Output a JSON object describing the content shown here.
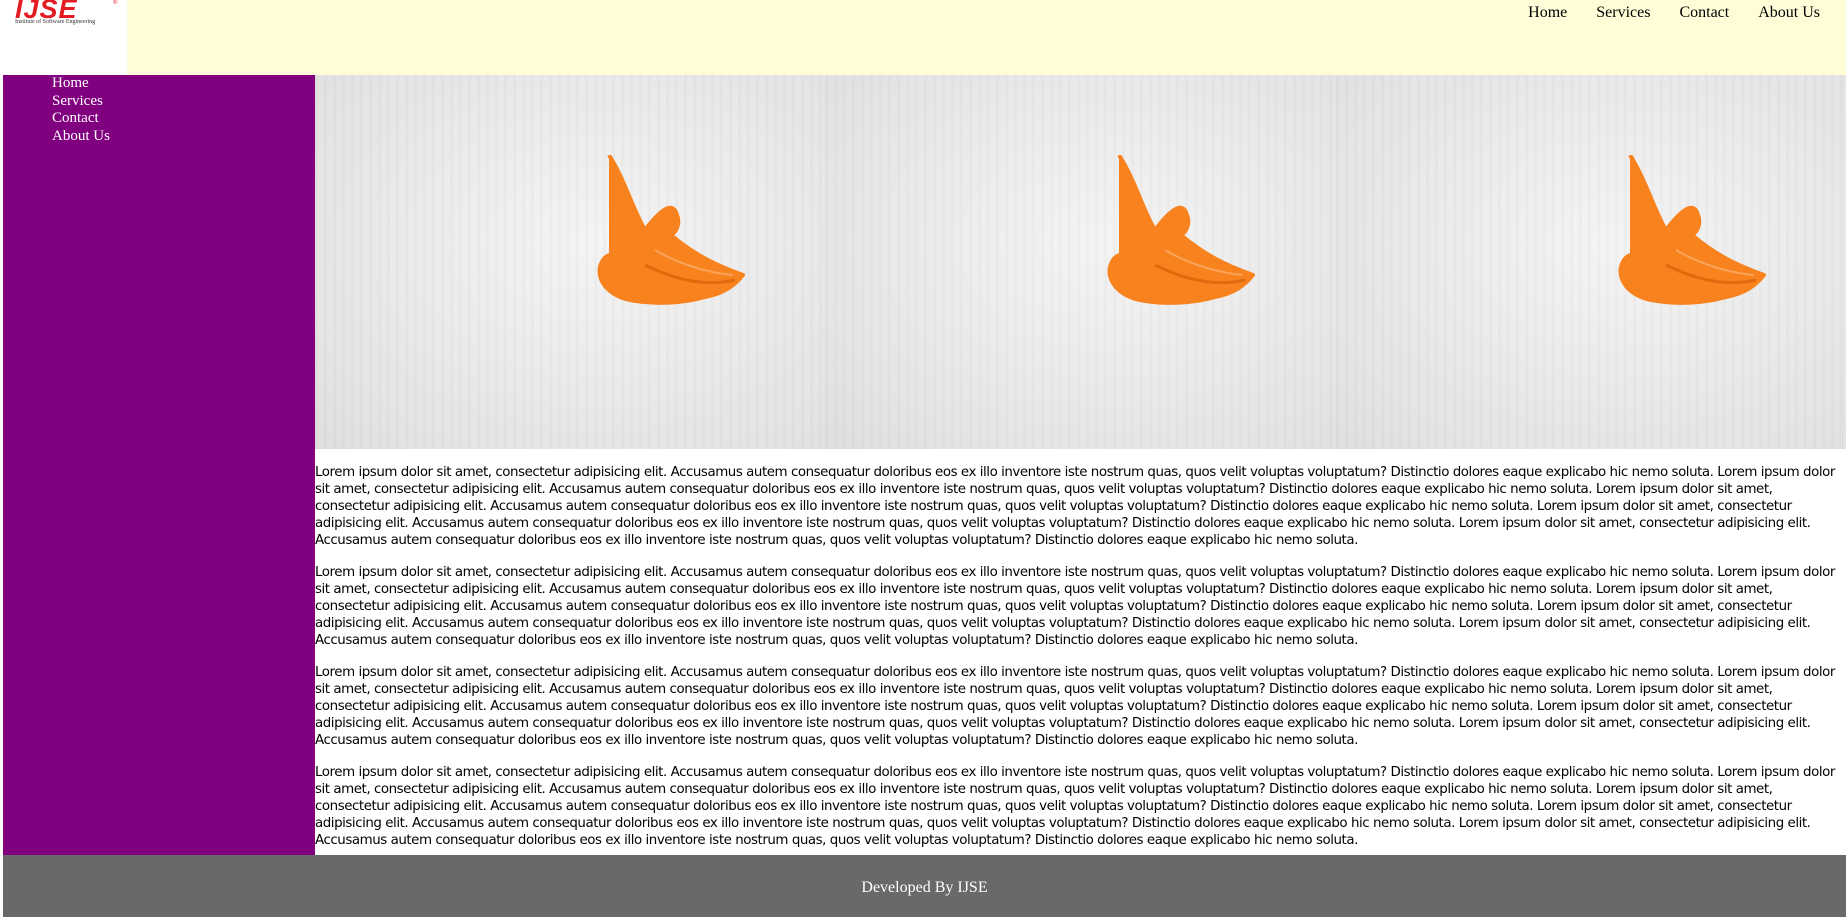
{
  "brand": {
    "logo_text": "IJSE",
    "logo_mark": "®",
    "logo_subtitle": "Institute of Software Engineering"
  },
  "header": {
    "nav": [
      "Home",
      "Services",
      "Contact",
      "About Us"
    ]
  },
  "sidebar": {
    "nav": [
      "Home",
      "Services",
      "Contact",
      "About Us"
    ]
  },
  "banner": {
    "image_icon": "orange-swirl-mascot-image",
    "tile_count": 3
  },
  "content": {
    "paragraphs": [
      "Lorem ipsum dolor sit amet, consectetur adipisicing elit. Accusamus autem consequatur doloribus eos ex illo inventore iste nostrum quas, quos velit voluptas voluptatum? Distinctio dolores eaque explicabo hic nemo soluta. Lorem ipsum dolor sit amet, consectetur adipisicing elit. Accusamus autem consequatur doloribus eos ex illo inventore iste nostrum quas, quos velit voluptas voluptatum? Distinctio dolores eaque explicabo hic nemo soluta. Lorem ipsum dolor sit amet, consectetur adipisicing elit. Accusamus autem consequatur doloribus eos ex illo inventore iste nostrum quas, quos velit voluptas voluptatum? Distinctio dolores eaque explicabo hic nemo soluta. Lorem ipsum dolor sit amet, consectetur adipisicing elit. Accusamus autem consequatur doloribus eos ex illo inventore iste nostrum quas, quos velit voluptas voluptatum? Distinctio dolores eaque explicabo hic nemo soluta. Lorem ipsum dolor sit amet, consectetur adipisicing elit. Accusamus autem consequatur doloribus eos ex illo inventore iste nostrum quas, quos velit voluptas voluptatum? Distinctio dolores eaque explicabo hic nemo soluta.",
      "Lorem ipsum dolor sit amet, consectetur adipisicing elit. Accusamus autem consequatur doloribus eos ex illo inventore iste nostrum quas, quos velit voluptas voluptatum? Distinctio dolores eaque explicabo hic nemo soluta. Lorem ipsum dolor sit amet, consectetur adipisicing elit. Accusamus autem consequatur doloribus eos ex illo inventore iste nostrum quas, quos velit voluptas voluptatum? Distinctio dolores eaque explicabo hic nemo soluta. Lorem ipsum dolor sit amet, consectetur adipisicing elit. Accusamus autem consequatur doloribus eos ex illo inventore iste nostrum quas, quos velit voluptas voluptatum? Distinctio dolores eaque explicabo hic nemo soluta. Lorem ipsum dolor sit amet, consectetur adipisicing elit. Accusamus autem consequatur doloribus eos ex illo inventore iste nostrum quas, quos velit voluptas voluptatum? Distinctio dolores eaque explicabo hic nemo soluta. Lorem ipsum dolor sit amet, consectetur adipisicing elit. Accusamus autem consequatur doloribus eos ex illo inventore iste nostrum quas, quos velit voluptas voluptatum? Distinctio dolores eaque explicabo hic nemo soluta.",
      "Lorem ipsum dolor sit amet, consectetur adipisicing elit. Accusamus autem consequatur doloribus eos ex illo inventore iste nostrum quas, quos velit voluptas voluptatum? Distinctio dolores eaque explicabo hic nemo soluta. Lorem ipsum dolor sit amet, consectetur adipisicing elit. Accusamus autem consequatur doloribus eos ex illo inventore iste nostrum quas, quos velit voluptas voluptatum? Distinctio dolores eaque explicabo hic nemo soluta. Lorem ipsum dolor sit amet, consectetur adipisicing elit. Accusamus autem consequatur doloribus eos ex illo inventore iste nostrum quas, quos velit voluptas voluptatum? Distinctio dolores eaque explicabo hic nemo soluta. Lorem ipsum dolor sit amet, consectetur adipisicing elit. Accusamus autem consequatur doloribus eos ex illo inventore iste nostrum quas, quos velit voluptas voluptatum? Distinctio dolores eaque explicabo hic nemo soluta. Lorem ipsum dolor sit amet, consectetur adipisicing elit. Accusamus autem consequatur doloribus eos ex illo inventore iste nostrum quas, quos velit voluptas voluptatum? Distinctio dolores eaque explicabo hic nemo soluta.",
      "Lorem ipsum dolor sit amet, consectetur adipisicing elit. Accusamus autem consequatur doloribus eos ex illo inventore iste nostrum quas, quos velit voluptas voluptatum? Distinctio dolores eaque explicabo hic nemo soluta. Lorem ipsum dolor sit amet, consectetur adipisicing elit. Accusamus autem consequatur doloribus eos ex illo inventore iste nostrum quas, quos velit voluptas voluptatum? Distinctio dolores eaque explicabo hic nemo soluta. Lorem ipsum dolor sit amet, consectetur adipisicing elit. Accusamus autem consequatur doloribus eos ex illo inventore iste nostrum quas, quos velit voluptas voluptatum? Distinctio dolores eaque explicabo hic nemo soluta. Lorem ipsum dolor sit amet, consectetur adipisicing elit. Accusamus autem consequatur doloribus eos ex illo inventore iste nostrum quas, quos velit voluptas voluptatum? Distinctio dolores eaque explicabo hic nemo soluta. Lorem ipsum dolor sit amet, consectetur adipisicing elit. Accusamus autem consequatur doloribus eos ex illo inventore iste nostrum quas, quos velit voluptas voluptatum? Distinctio dolores eaque explicabo hic nemo soluta."
    ]
  },
  "footer": {
    "text": "Developed By IJSE"
  },
  "colors": {
    "header_bg": "#fffdd8",
    "sidebar_bg": "#800080",
    "footer_bg": "#696969",
    "logo_red": "#e31b23",
    "mascot_orange": "#f7821e"
  }
}
